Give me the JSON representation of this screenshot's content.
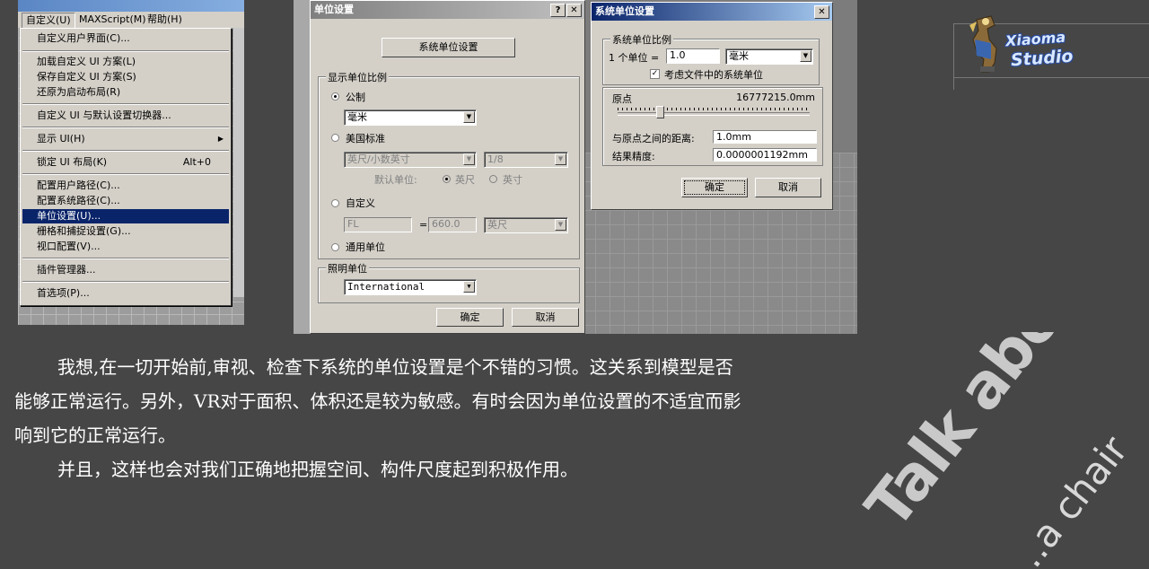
{
  "menu": {
    "bar": [
      "自定义(U)",
      "MAXScript(M)",
      "帮助(H)"
    ],
    "items": {
      "customize_ui": "自定义用户界面(C)...",
      "load_scheme": "加载自定义 UI 方案(L)",
      "save_scheme": "保存自定义 UI 方案(S)",
      "revert_startup": "还原为启动布局(R)",
      "ui_switcher": "自定义 UI 与默认设置切换器...",
      "show_ui": "显示 UI(H)",
      "lock_ui": "锁定 UI 布局(K)",
      "lock_ui_shortcut": "Alt+0",
      "user_paths": "配置用户路径(C)...",
      "system_paths": "配置系统路径(C)...",
      "units_setup": "单位设置(U)...",
      "grid_snap": "栅格和捕捉设置(G)...",
      "viewport_config": "视口配置(V)...",
      "plugin_manager": "插件管理器...",
      "preferences": "首选项(P)..."
    }
  },
  "units_dialog": {
    "title": "单位设置",
    "help_btn": "?",
    "close_btn": "✕",
    "system_setup_btn": "系统单位设置",
    "display_group": "显示单位比例",
    "metric": "公制",
    "metric_value": "毫米",
    "us_standard": "美国标准",
    "us_value": "英尺/小数英寸",
    "us_fraction": "1/8",
    "default_unit_label": "默认单位:",
    "feet": "英尺",
    "inches": "英寸",
    "custom": "自定义",
    "custom_name": "FL",
    "equals": "=",
    "custom_value": "660.0",
    "custom_unit": "英尺",
    "generic": "通用单位",
    "lighting_group": "照明单位",
    "lighting_value": "International",
    "ok": "确定",
    "cancel": "取消"
  },
  "system_dialog": {
    "title": "系统单位设置",
    "close_btn": "✕",
    "scale_group": "系统单位比例",
    "one_unit": "1 个单位 =",
    "unit_value": "1.0",
    "unit_type": "毫米",
    "respect_files": "考虑文件中的系统单位",
    "respect_checked": "✓",
    "origin_label": "原点",
    "origin_value": "16777215.0mm",
    "slider_position": 0.22,
    "distance_label": "与原点之间的距离:",
    "distance_value": "1.0mm",
    "precision_label": "结果精度:",
    "precision_value": "0.0000001192mm",
    "ok": "确定",
    "cancel": "取消"
  },
  "logo": {
    "line1": "Xiaoma",
    "line2": "Studio"
  },
  "text": {
    "p1_line1": "我想,在一切开始前,审视、检查下系统的单位设置是个不错的习惯。这关系到模型是否",
    "p1_line2": "能够正常运行。另外，VR对于面积、体积还是较为敏感。有时会因为单位设置的不适宜而影",
    "p1_line3": "响到它的正常运行。",
    "p2": "并且，这样也会对我们正确地把握空间、构件尺度起到积极作用。"
  },
  "watermark": {
    "big": "Talk about",
    "small": "....a chair"
  }
}
